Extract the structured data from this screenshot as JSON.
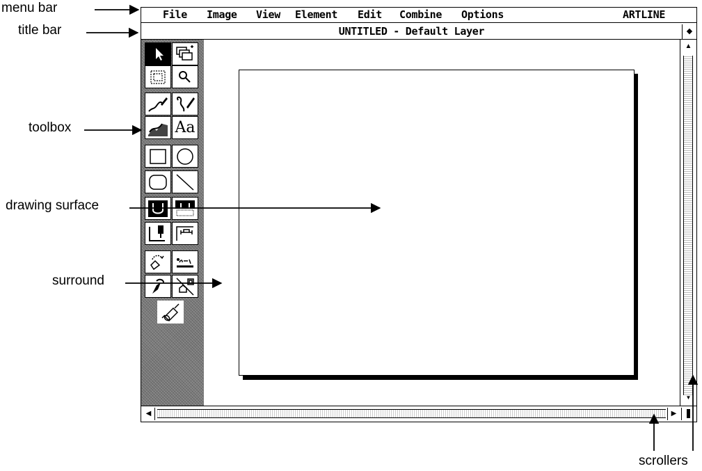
{
  "menu": {
    "items": [
      "File",
      "Image",
      "View",
      "Element",
      "Edit",
      "Combine",
      "Options"
    ],
    "app_name": "ARTLINE"
  },
  "title_bar": {
    "title": "UNTITLED - Default Layer"
  },
  "callouts": {
    "menu_bar": "menu bar",
    "title_bar": "title bar",
    "toolbox": "toolbox",
    "drawing_surface": "drawing surface",
    "surround": "surround",
    "scrollers": "scrollers"
  },
  "tools": [
    {
      "name": "select-arrow-icon"
    },
    {
      "name": "layers-icon"
    },
    {
      "name": "marquee-select-icon"
    },
    {
      "name": "magnifier-icon"
    },
    {
      "name": "freehand-pen-icon"
    },
    {
      "name": "curve-pen-icon"
    },
    {
      "name": "brush-stroke-icon"
    },
    {
      "name": "text-tool-icon",
      "glyph": "Aa"
    },
    {
      "name": "rectangle-icon"
    },
    {
      "name": "ellipse-icon"
    },
    {
      "name": "rounded-rect-icon"
    },
    {
      "name": "line-icon"
    },
    {
      "name": "fill-bucket-icon"
    },
    {
      "name": "pattern-fill-icon"
    },
    {
      "name": "dropper-corner-icon"
    },
    {
      "name": "dimension-icon"
    },
    {
      "name": "rotate-icon"
    },
    {
      "name": "align-text-icon"
    },
    {
      "name": "eraser-icon"
    },
    {
      "name": "home-icon"
    },
    {
      "name": "rolling-pin-icon"
    }
  ]
}
